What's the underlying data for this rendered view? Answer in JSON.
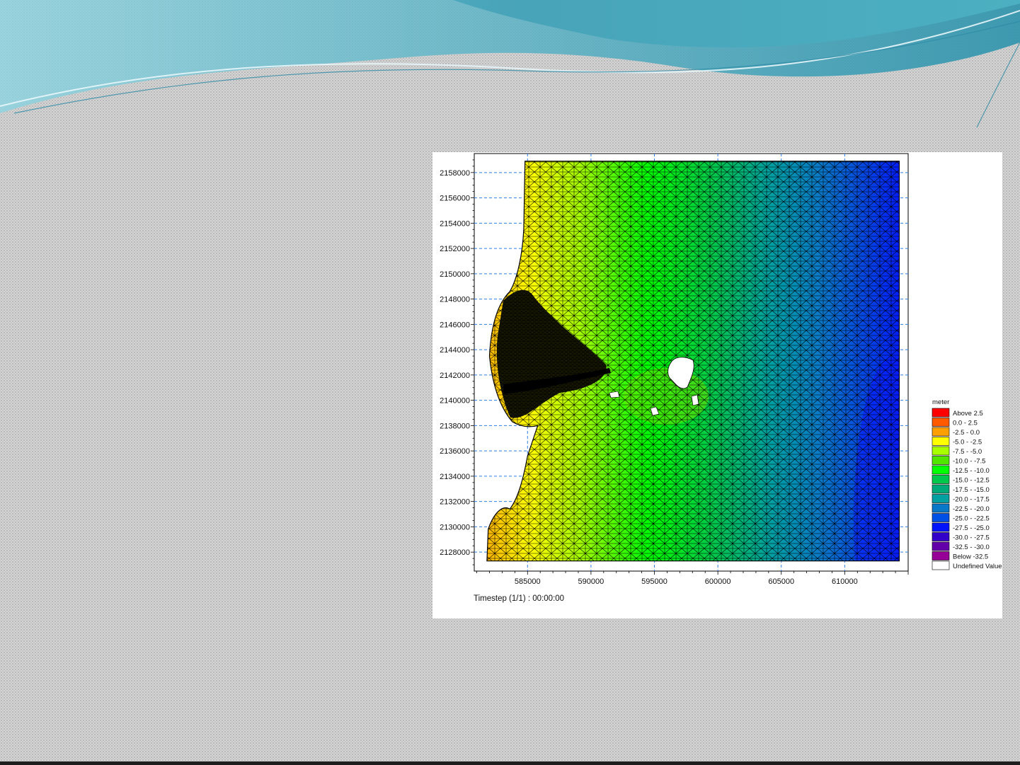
{
  "slide": {
    "theme_colors": {
      "banner_dark": "#3aa5b8",
      "banner_light": "#8fd0dc",
      "banner_mid": "#5ab8c8"
    }
  },
  "chart_data": {
    "type": "heatmap",
    "title": "",
    "xlabel": "",
    "ylabel": "",
    "footer": "Timestep (1/1) : 00:00:00",
    "x_ticks": [
      585000,
      590000,
      595000,
      600000,
      605000,
      610000
    ],
    "y_ticks": [
      2128000,
      2130000,
      2132000,
      2134000,
      2136000,
      2138000,
      2140000,
      2142000,
      2144000,
      2146000,
      2148000,
      2150000,
      2152000,
      2154000,
      2156000,
      2158000
    ],
    "xlim": [
      580800,
      615000
    ],
    "ylim": [
      2126500,
      2159500
    ],
    "grid": true,
    "mesh": "triangular",
    "legend": {
      "title": "meter",
      "placement": "right",
      "entries": [
        {
          "label": "Above    2.5",
          "color": "#ff0000"
        },
        {
          "label": "0.0 -    2.5",
          "color": "#ff5a00"
        },
        {
          "label": "-2.5 -    0.0",
          "color": "#ffa000"
        },
        {
          "label": "-5.0 -   -2.5",
          "color": "#ffff00"
        },
        {
          "label": "-7.5 -   -5.0",
          "color": "#a8ff00"
        },
        {
          "label": "-10.0 -   -7.5",
          "color": "#50e600"
        },
        {
          "label": "-12.5 - -10.0",
          "color": "#00ff00"
        },
        {
          "label": "-15.0 - -12.5",
          "color": "#00c84a"
        },
        {
          "label": "-17.5 - -15.0",
          "color": "#00aa78"
        },
        {
          "label": "-20.0 - -17.5",
          "color": "#00a0a0"
        },
        {
          "label": "-22.5 - -20.0",
          "color": "#0a78c8"
        },
        {
          "label": "-25.0 - -22.5",
          "color": "#0050e6"
        },
        {
          "label": "-27.5 - -25.0",
          "color": "#0014ff"
        },
        {
          "label": "-30.0 - -27.5",
          "color": "#3200c8"
        },
        {
          "label": "-32.5 - -30.0",
          "color": "#6400aa"
        },
        {
          "label": "Below  -32.5",
          "color": "#960096"
        },
        {
          "label": "Undefined Value",
          "color": "#ffffff"
        }
      ]
    },
    "field_zones": [
      {
        "x_from": 583000,
        "x_to": 587500,
        "value_range": "-2.5 - 0.0 (coast, orange/yellow)"
      },
      {
        "x_from": 587500,
        "x_to": 592000,
        "value_range": "-7.5 - -5.0"
      },
      {
        "x_from": 592000,
        "x_to": 598000,
        "value_range": "-12.5 - -7.5"
      },
      {
        "x_from": 598000,
        "x_to": 603000,
        "value_range": "-17.5 - -12.5"
      },
      {
        "x_from": 603000,
        "x_to": 608000,
        "value_range": "-22.5 - -20.0"
      },
      {
        "x_from": 608000,
        "x_to": 614500,
        "value_range": "-27.5 - -22.5"
      }
    ]
  }
}
